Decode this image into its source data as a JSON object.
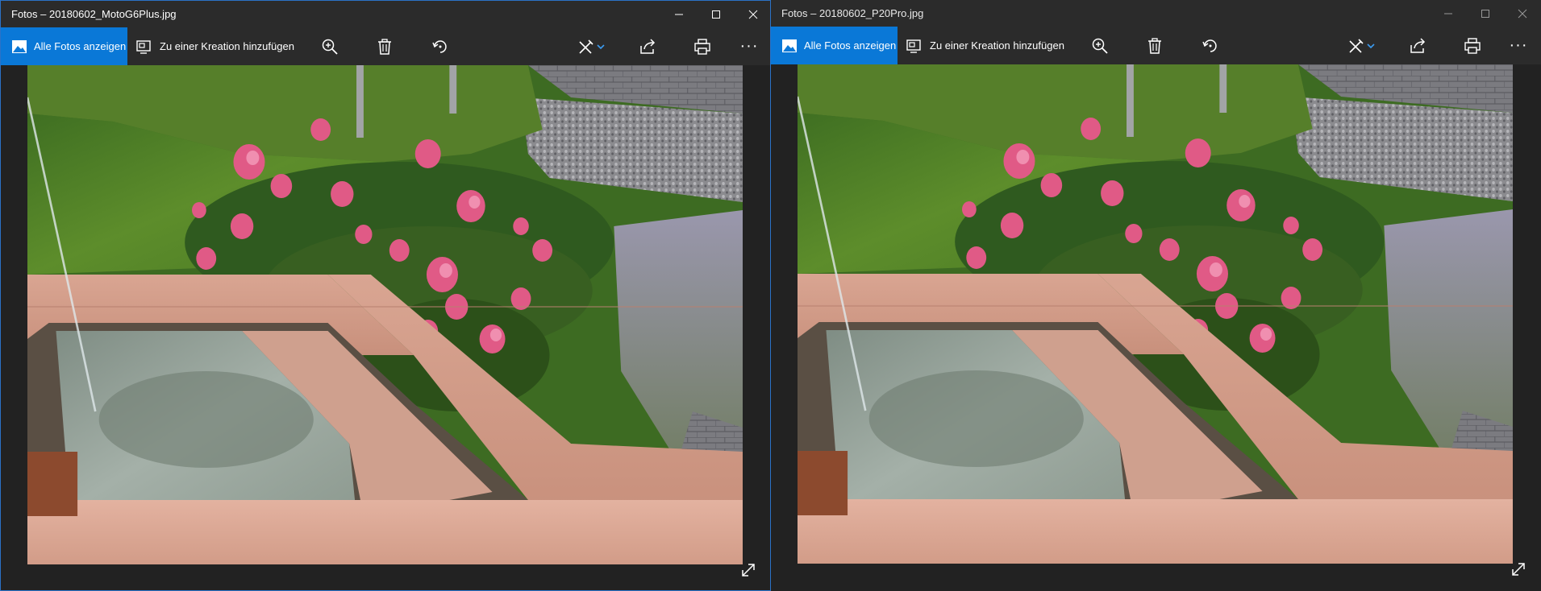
{
  "windows": [
    {
      "title": "Fotos – 20180602_MotoG6Plus.jpg",
      "toolbar": {
        "all_photos_label": "Alle Fotos anzeigen",
        "add_creation_label": "Zu einer Kreation hinzufügen",
        "more_label": "···"
      }
    },
    {
      "title": "Fotos – 20180602_P20Pro.jpg",
      "toolbar": {
        "all_photos_label": "Alle Fotos anzeigen",
        "add_creation_label": "Zu einer Kreation hinzufügen",
        "more_label": "···"
      }
    }
  ],
  "colors": {
    "accent": "#0a78d7",
    "active_border": "#2b72c7",
    "chrome": "#2b2b2b",
    "background": "#222222"
  },
  "icons": [
    "image-icon",
    "creation-icon",
    "zoom-in-icon",
    "trash-icon",
    "rotate-icon",
    "edit-icon",
    "chevron-down-icon",
    "share-icon",
    "print-icon",
    "more-icon",
    "expand-icon",
    "minimize-icon",
    "maximize-icon",
    "close-icon"
  ]
}
